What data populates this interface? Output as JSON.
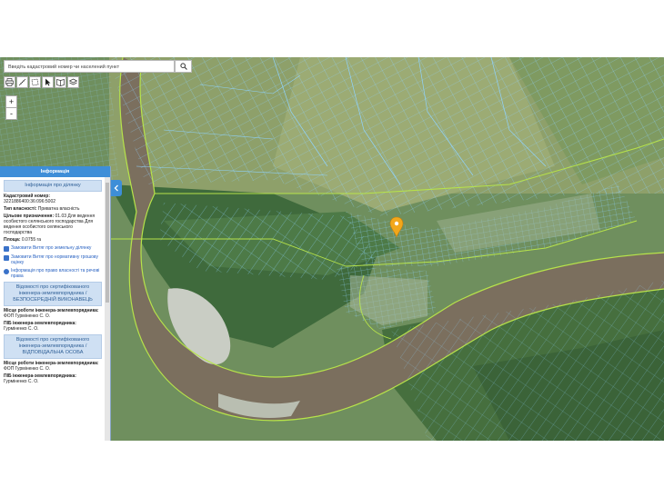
{
  "search": {
    "placeholder": "Введіть кадастровий номер чи населений пункт"
  },
  "toolbar": {
    "icons": [
      "printer-icon",
      "measure-distance-icon",
      "measure-area-icon",
      "pointer-icon",
      "book-icon",
      "layers-icon"
    ]
  },
  "zoom": {
    "in_label": "+",
    "out_label": "-"
  },
  "panel": {
    "title": "Інформація",
    "parcel_header": "Інформація про ділянку",
    "cadastral_label": "Кадастровий номер:",
    "cadastral_value": "3221886400:36:096:5002",
    "ownership_label": "Тип власності:",
    "ownership_value": "Приватна власність",
    "purpose_label": "Цільове призначення:",
    "purpose_value": "01.03 Для ведення особистого селянського господарства Для ведення особистого селянського господарства",
    "area_label": "Площа:",
    "area_value": "0.0755 га",
    "link_extract": "Замовити Витяг про земельну ділянку",
    "link_valuation": "Замовити Витяг про нормативну грошову оцінку",
    "link_rights": "Інформація про право власності та речові права",
    "engineer_header_1": "Відомості про сертифікованого інженера-землевпорядника / БЕЗПОСЕРЕДНІЙ ВИКОНАВЕЦЬ",
    "workplace_label_1": "Місце роботи інженера-землевпорядника:",
    "workplace_value_1": "ФОП Гурміненко С. О.",
    "name_label_1": "ПІБ інженера-землевпорядника:",
    "name_value_1": "Гурміненко С. О.",
    "engineer_header_2": "Відомості про сертифікованого інженера-землевпорядника / ВІДПОВІДАЛЬНА ОСОБА",
    "workplace_label_2": "Місце роботи інженера-землевпорядника:",
    "workplace_value_2": "ФОП Гурміненко С. О.",
    "name_label_2": "ПІБ інженера-землевпорядника:",
    "name_value_2": "Гурміненко С. О."
  },
  "colors": {
    "panel_header": "#3e8ed8",
    "section_bg": "#cfe0f3",
    "link": "#2a63c2",
    "parcel_lines": "#8fd3ff",
    "boundary_lines": "#b7e34a",
    "marker": "#f2a71b"
  }
}
